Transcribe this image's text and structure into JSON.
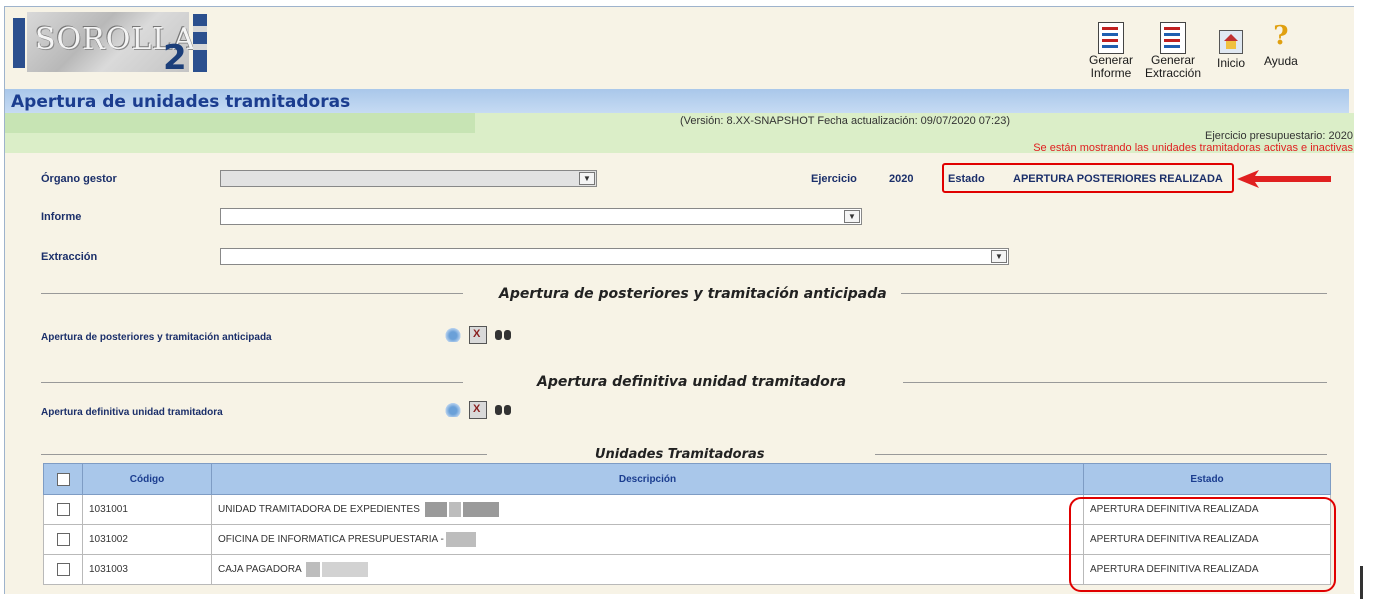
{
  "app": {
    "logo": "SOROLLA",
    "logo_suffix": "2"
  },
  "toolbar": {
    "generar_informe": [
      "Generar",
      "Informe"
    ],
    "generar_extraccion": [
      "Generar",
      "Extracción"
    ],
    "inicio": "Inicio",
    "ayuda": "Ayuda"
  },
  "page": {
    "title": "Apertura de unidades tramitadoras",
    "version": "(Versión: 8.XX-SNAPSHOT Fecha actualización: 09/07/2020 07:23)",
    "ejercicio_presupuestario": "Ejercicio presupuestario: 2020",
    "warning": "Se están mostrando las unidades tramitadoras activas e inactivas"
  },
  "form": {
    "organo_label": "Órgano gestor",
    "organo_value": "",
    "ejercicio_label": "Ejercicio",
    "ejercicio_value": "2020",
    "estado_label": "Estado",
    "estado_value": "APERTURA POSTERIORES REALIZADA",
    "informe_label": "Informe",
    "informe_value": "",
    "extraccion_label": "Extracción",
    "extraccion_value": ""
  },
  "sections": {
    "posteriores_title": "Apertura de posteriores y tramitación anticipada",
    "posteriores_label": "Apertura de posteriores y tramitación anticipada",
    "definitiva_title": "Apertura definitiva unidad tramitadora",
    "definitiva_label": "Apertura definitiva unidad tramitadora",
    "unidades_title": "Unidades Tramitadoras"
  },
  "table": {
    "headers": {
      "codigo": "Código",
      "descripcion": "Descripción",
      "estado": "Estado"
    },
    "rows": [
      {
        "codigo": "1031001",
        "descripcion": "UNIDAD TRAMITADORA DE EXPEDIENTES",
        "estado": "APERTURA DEFINITIVA REALIZADA"
      },
      {
        "codigo": "1031002",
        "descripcion": "OFICINA DE INFORMATICA PRESUPUESTARIA -",
        "estado": "APERTURA DEFINITIVA REALIZADA"
      },
      {
        "codigo": "1031003",
        "descripcion": "CAJA PAGADORA",
        "estado": "APERTURA DEFINITIVA REALIZADA"
      }
    ]
  },
  "colors": {
    "title_bar": "#a9c7ea",
    "info_bar": "#dbeec8",
    "highlight": "#e00000",
    "warning": "#e02020"
  }
}
